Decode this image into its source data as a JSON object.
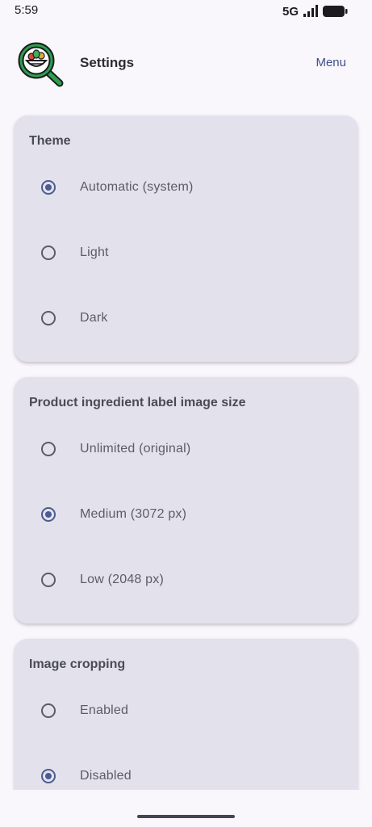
{
  "status_bar": {
    "time": "5:59",
    "network": "5G"
  },
  "app_bar": {
    "title": "Settings",
    "menu_label": "Menu"
  },
  "colors": {
    "accent": "#4c5c92",
    "card_background": "#e3e2ec",
    "page_background": "#f9f6fc"
  },
  "sections": [
    {
      "title": "Theme",
      "options": [
        {
          "label": "Automatic (system)",
          "selected": true
        },
        {
          "label": "Light",
          "selected": false
        },
        {
          "label": "Dark",
          "selected": false
        }
      ]
    },
    {
      "title": "Product ingredient label image size",
      "options": [
        {
          "label": "Unlimited (original)",
          "selected": false
        },
        {
          "label": "Medium (3072 px)",
          "selected": true
        },
        {
          "label": "Low (2048 px)",
          "selected": false
        }
      ]
    },
    {
      "title": "Image cropping",
      "options": [
        {
          "label": "Enabled",
          "selected": false
        },
        {
          "label": "Disabled",
          "selected": true
        }
      ]
    }
  ]
}
